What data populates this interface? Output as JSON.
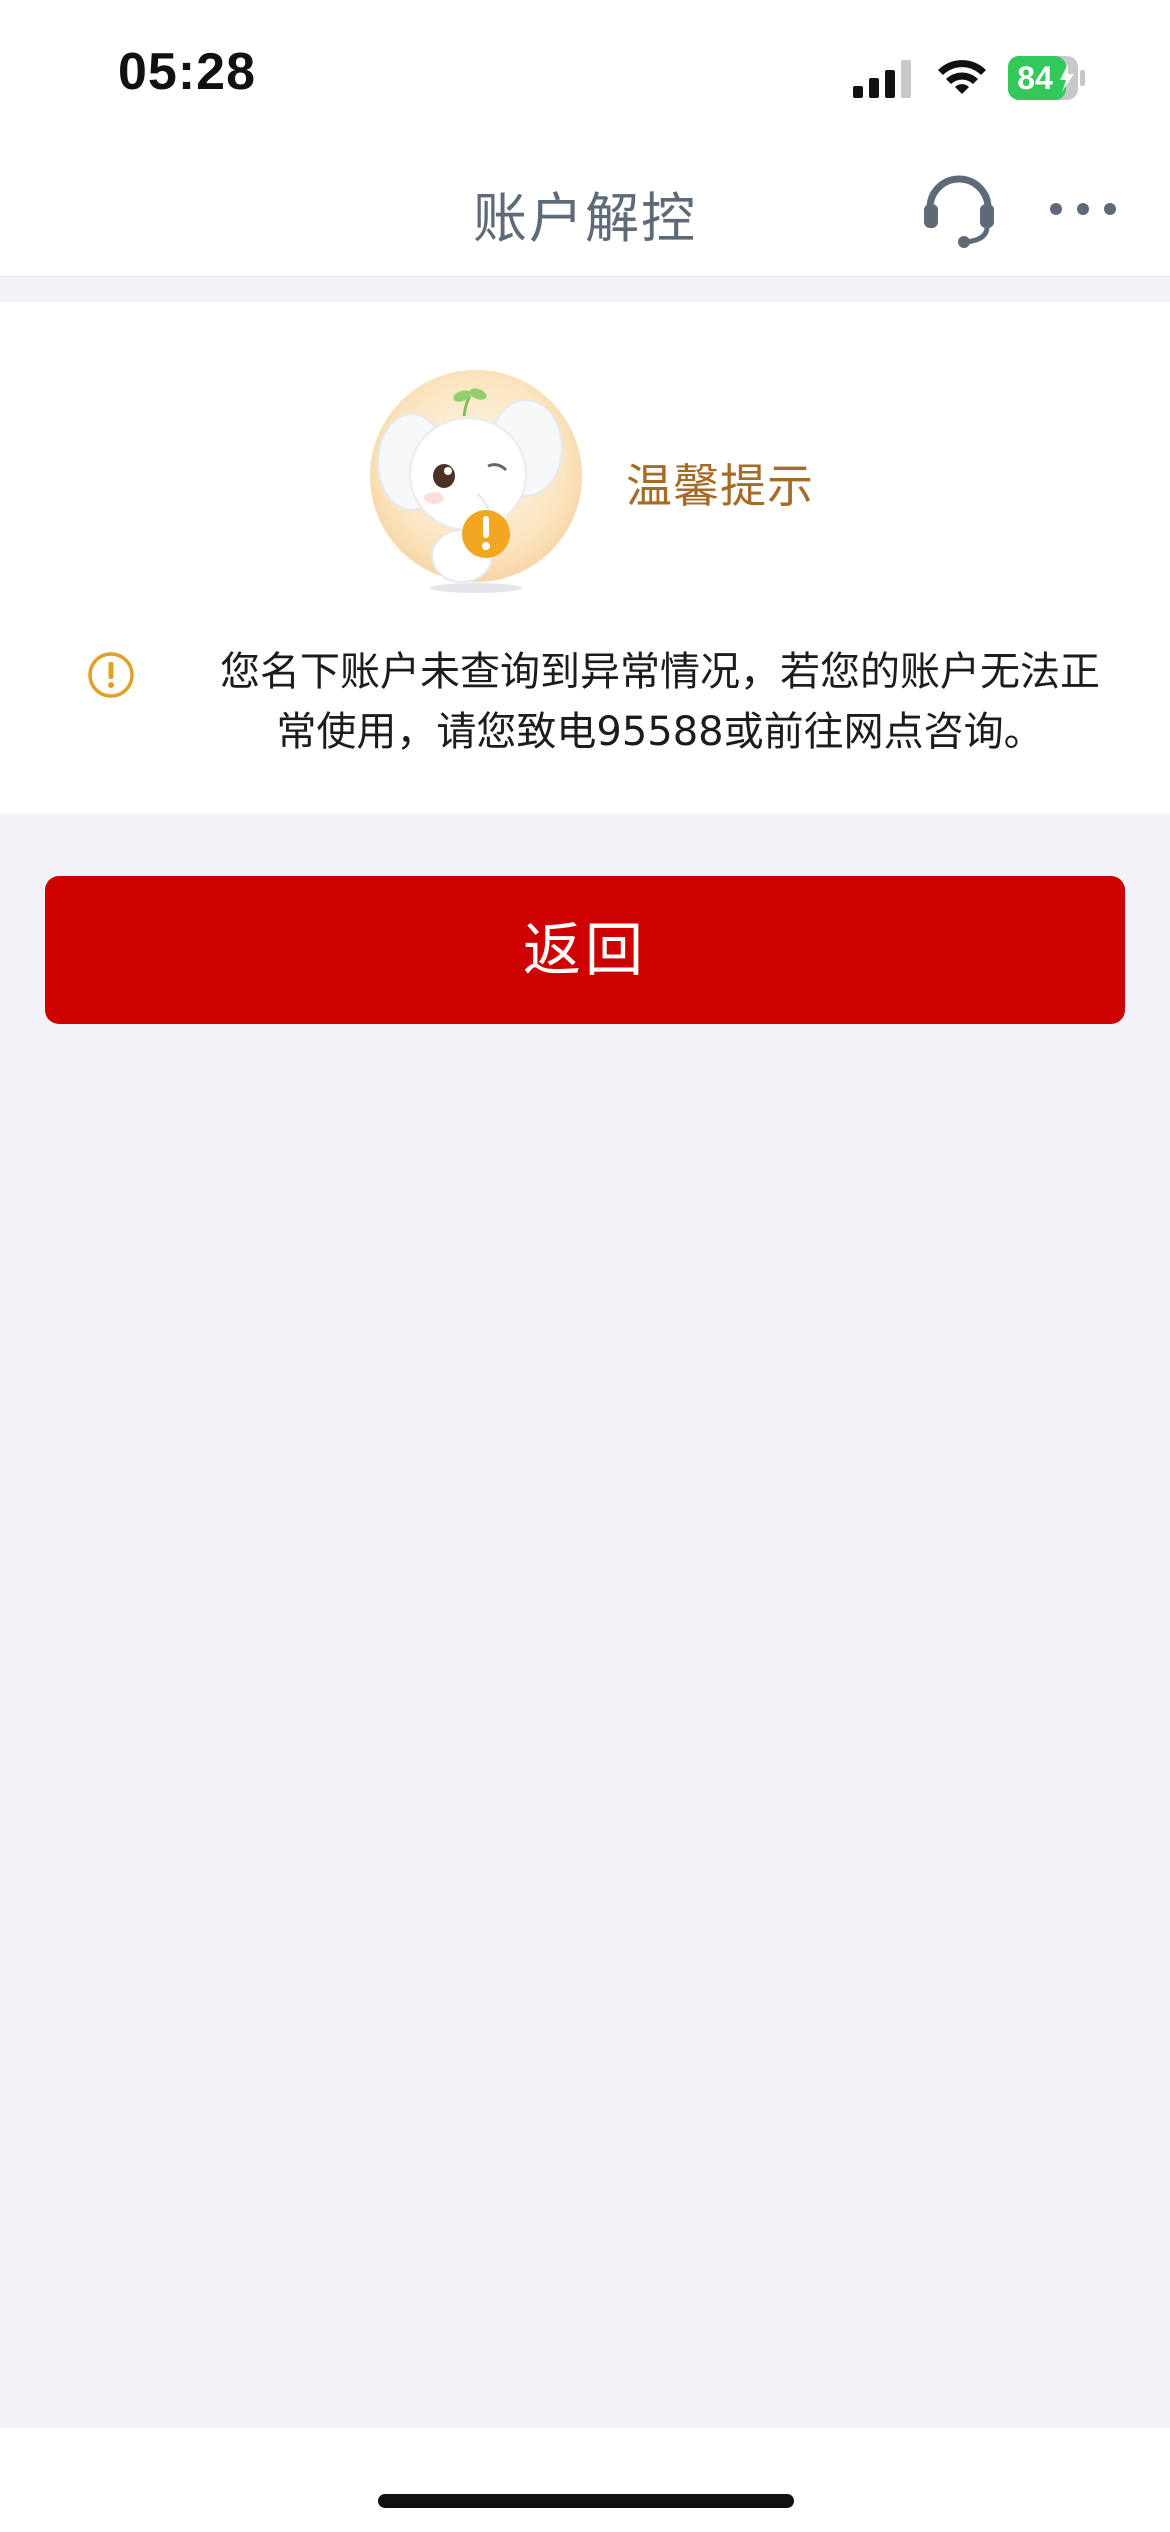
{
  "status_bar": {
    "time": "05:28",
    "battery": "84"
  },
  "nav": {
    "title": "账户解控",
    "icons": [
      "headset-icon",
      "more-icon"
    ]
  },
  "card": {
    "tip_title": "温馨提示",
    "message_line1": "您名下账户未查询到异常情况，若您的账户无法正",
    "message_line2": "常使用，请您致电95588或前往网点咨询。"
  },
  "actions": {
    "back_label": "返回"
  },
  "colors": {
    "accent_red": "#cf0000",
    "tip_brown": "#a66b24",
    "warning_orange": "#e0a12a"
  }
}
